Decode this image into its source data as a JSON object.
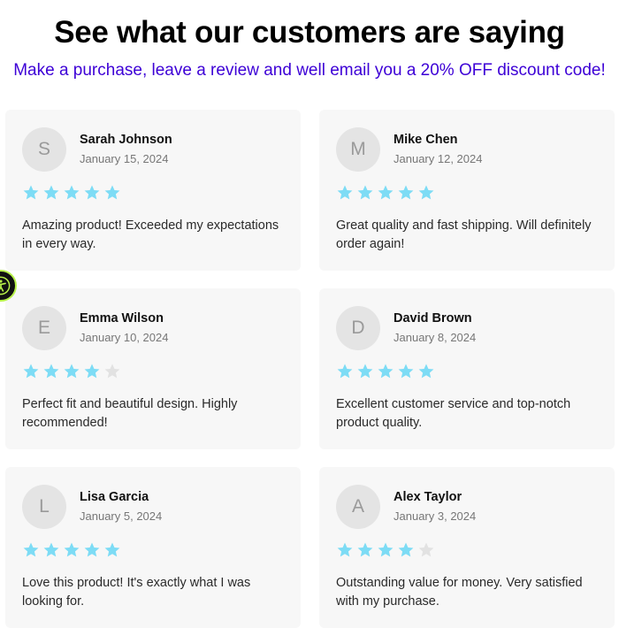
{
  "header": {
    "title": "See what our customers are saying",
    "subtitle": "Make a purchase, leave a review and well email you a 20% OFF discount code!",
    "subtitle_color": "#3d00d6"
  },
  "colors": {
    "star_filled": "#7ddcf5",
    "star_empty": "#e2e2e2",
    "card_bg": "#f7f7f7"
  },
  "accessibility_button": {
    "icon": "accessibility-person-icon",
    "accent": "#b8f24a"
  },
  "reviews": [
    {
      "initial": "S",
      "name": "Sarah Johnson",
      "date": "January 15, 2024",
      "rating": 5,
      "text": "Amazing product! Exceeded my expectations in every way."
    },
    {
      "initial": "M",
      "name": "Mike Chen",
      "date": "January 12, 2024",
      "rating": 5,
      "text": "Great quality and fast shipping. Will definitely order again!"
    },
    {
      "initial": "E",
      "name": "Emma Wilson",
      "date": "January 10, 2024",
      "rating": 4,
      "text": "Perfect fit and beautiful design. Highly recommended!"
    },
    {
      "initial": "D",
      "name": "David Brown",
      "date": "January 8, 2024",
      "rating": 5,
      "text": "Excellent customer service and top-notch product quality."
    },
    {
      "initial": "L",
      "name": "Lisa Garcia",
      "date": "January 5, 2024",
      "rating": 5,
      "text": "Love this product! It's exactly what I was looking for."
    },
    {
      "initial": "A",
      "name": "Alex Taylor",
      "date": "January 3, 2024",
      "rating": 4,
      "text": "Outstanding value for money. Very satisfied with my purchase."
    }
  ]
}
